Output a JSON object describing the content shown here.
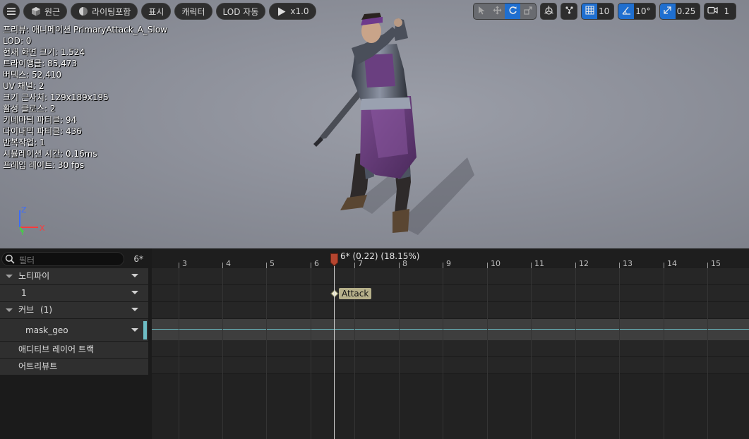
{
  "toolbar": {
    "menu_icon": "hamburger-icon",
    "perspective_label": "원근",
    "lighting_label": "라이팅포함",
    "show_label": "표시",
    "character_label": "캐릭터",
    "lod_label": "LOD 자동",
    "play_speed_label": "x1.0",
    "grid_snap_value": "10",
    "rotation_snap_value": "10°",
    "scale_snap_value": "0.25",
    "camera_speed_value": "1"
  },
  "stats": [
    "프리뷰: 애니메이션 PrimaryAttack_A_Slow",
    "LOD: 0",
    "현재 화면 크기: 1.524",
    "트라이앵글: 85,473",
    "버텍스: 52,410",
    "UV 채널: 2",
    "크기 근사치: 129x189x195",
    "활성 클로스: 2",
    "키네마틱 파티클: 94",
    "다이내믹 파티클: 436",
    "반복작업: 1",
    "시뮬레이션 시간: 0.16ms",
    "프레임 레이트: 30 fps"
  ],
  "axis": {
    "x": "X",
    "y": "Y",
    "z": "Z"
  },
  "timeline": {
    "filter_placeholder": "필터",
    "current_frame": "6*",
    "playhead_label": "6* (0.22) (18.15%)",
    "tracks": {
      "notifies_label": "노티파이",
      "notify_track_label": "1",
      "curves_label": "커브",
      "curves_count": "(1)",
      "curve_name": "mask_geo",
      "additive_label": "애디티브 레이어 트랙",
      "attributes_label": "어트리뷰트"
    },
    "notify_name": "Attack",
    "ticks": [
      "3",
      "4",
      "5",
      "6",
      "7",
      "8",
      "9",
      "10",
      "11",
      "12",
      "13",
      "14",
      "15"
    ]
  },
  "colors": {
    "accent_blue": "#1f6fd0",
    "curve_color": "#6dbcc4",
    "playhead_color": "#b5452f",
    "notify_color": "#b6b08a"
  }
}
